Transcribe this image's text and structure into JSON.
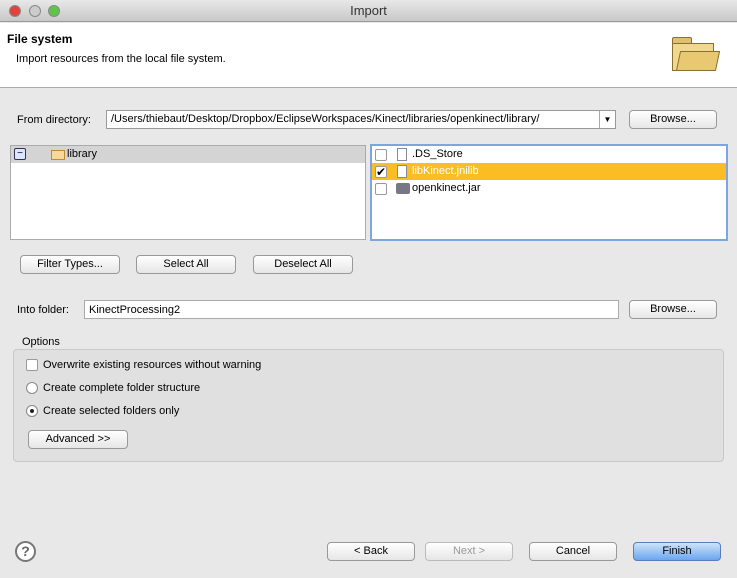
{
  "window": {
    "title": "Import"
  },
  "header": {
    "title": "File system",
    "description": "Import resources from the local file system."
  },
  "from_directory": {
    "label": "From directory:",
    "value": "/Users/thiebaut/Desktop/Dropbox/EclipseWorkspaces/Kinect/libraries/openkinect/library/",
    "browse": "Browse..."
  },
  "tree": {
    "items": [
      {
        "label": "library",
        "expanded": true
      }
    ]
  },
  "files": {
    "items": [
      {
        "label": ".DS_Store",
        "checked": false
      },
      {
        "label": "libKinect.jnilib",
        "checked": true,
        "selected": true
      },
      {
        "label": "openkinect.jar",
        "checked": false
      }
    ]
  },
  "buttons": {
    "filter": "Filter Types...",
    "select_all": "Select All",
    "deselect_all": "Deselect All"
  },
  "into_folder": {
    "label": "Into folder:",
    "value": "KinectProcessing2",
    "browse": "Browse..."
  },
  "options": {
    "label": "Options",
    "overwrite": "Overwrite existing resources without warning",
    "complete": "Create complete folder structure",
    "selected_only": "Create selected folders only",
    "advanced": "Advanced >>"
  },
  "footer": {
    "back": "< Back",
    "next": "Next >",
    "cancel": "Cancel",
    "finish": "Finish"
  },
  "colors": {
    "selection": "#fbbd24",
    "default_button": "#6aa6ee"
  }
}
